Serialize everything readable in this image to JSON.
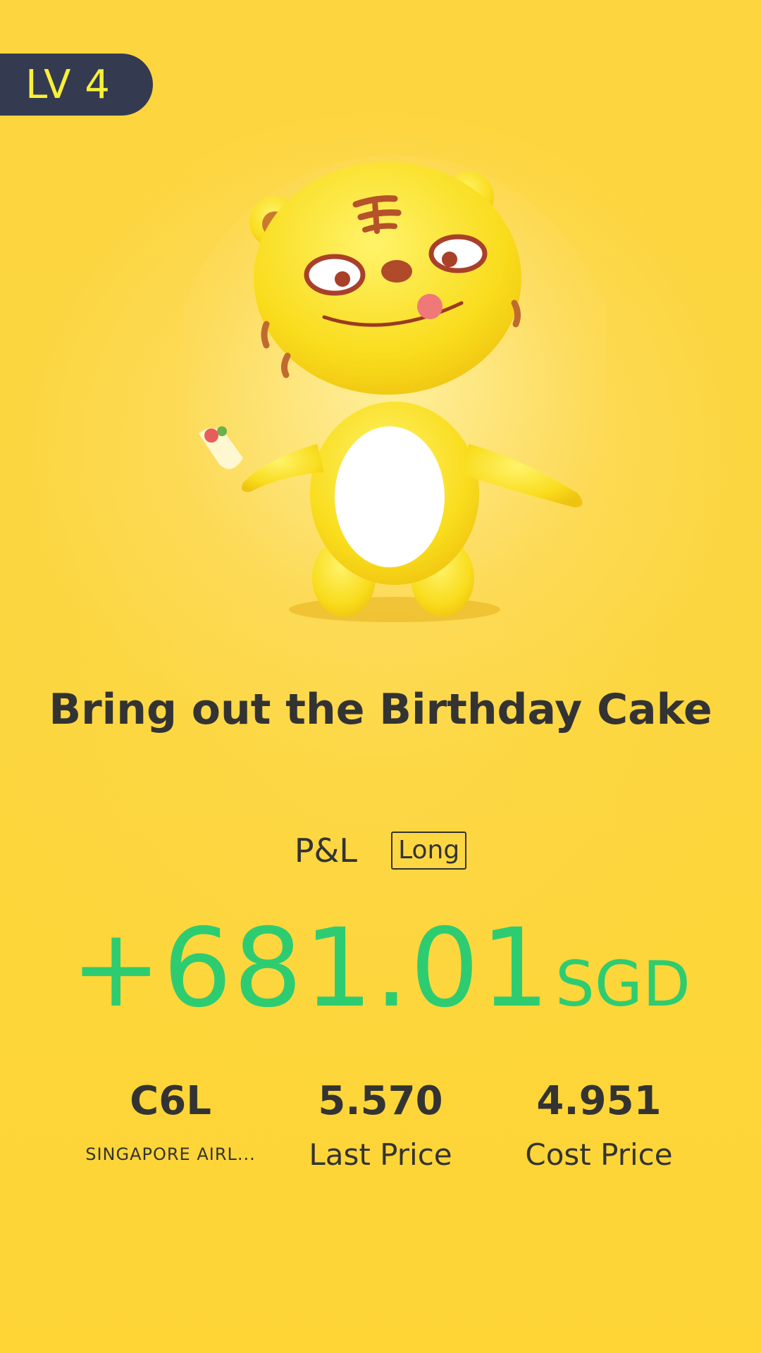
{
  "level": {
    "label": "LV 4"
  },
  "mascot": {
    "icon": "tiger-mascot-icon"
  },
  "headline": "Bring out the Birthday Cake",
  "pl": {
    "label": "P&L",
    "position_tag": "Long",
    "value": "+681.01",
    "currency": "SGD",
    "color": "#2ecc71"
  },
  "stats": {
    "symbol": {
      "value": "C6L",
      "label": "SINGAPORE AIRL..."
    },
    "last_price": {
      "value": "5.570",
      "label": "Last Price"
    },
    "cost_price": {
      "value": "4.951",
      "label": "Cost Price"
    }
  },
  "colors": {
    "background": "#fdd33a",
    "badge_bg": "#343a4f",
    "badge_text": "#f8f039",
    "text": "#333333"
  }
}
